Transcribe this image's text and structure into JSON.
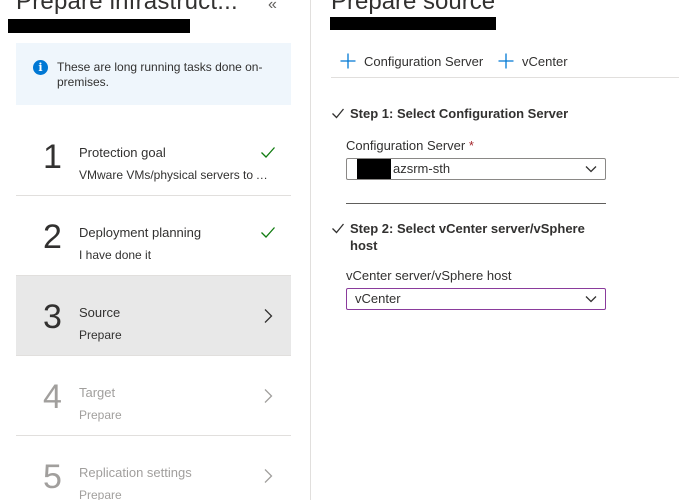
{
  "left": {
    "title": "Prepare infrastruct...",
    "collapse_glyph": "«",
    "info": {
      "icon": "info-icon",
      "text": "These are long running tasks done on-premises."
    },
    "steps": [
      {
        "number": "1",
        "title": "Protection goal",
        "subtitle": "VMware VMs/physical servers to Azure",
        "status": "done"
      },
      {
        "number": "2",
        "title": "Deployment planning",
        "subtitle": "I have done it",
        "status": "done"
      },
      {
        "number": "3",
        "title": "Source",
        "subtitle": "Prepare",
        "status": "active"
      },
      {
        "number": "4",
        "title": "Target",
        "subtitle": "Prepare",
        "status": "disabled"
      },
      {
        "number": "5",
        "title": "Replication settings",
        "subtitle": "Prepare",
        "status": "disabled"
      }
    ]
  },
  "right": {
    "title": "Prepare source",
    "toolbar": {
      "config_server_label": "Configuration Server",
      "vcenter_label": "vCenter"
    },
    "step1": {
      "heading": "Step 1: Select Configuration Server",
      "field_label": "Configuration Server",
      "required_mark": "*",
      "value": "azsrm-sth"
    },
    "step2": {
      "heading": "Step 2: Select vCenter server/vSphere host",
      "field_label": "vCenter server/vSphere host",
      "value": "vCenter"
    }
  },
  "colors": {
    "accent": "#0078d4",
    "success": "#107c10",
    "focus_border": "#8a3b9c",
    "active_step_bg": "#e8e8e8",
    "info_bg": "#eff6fc"
  }
}
